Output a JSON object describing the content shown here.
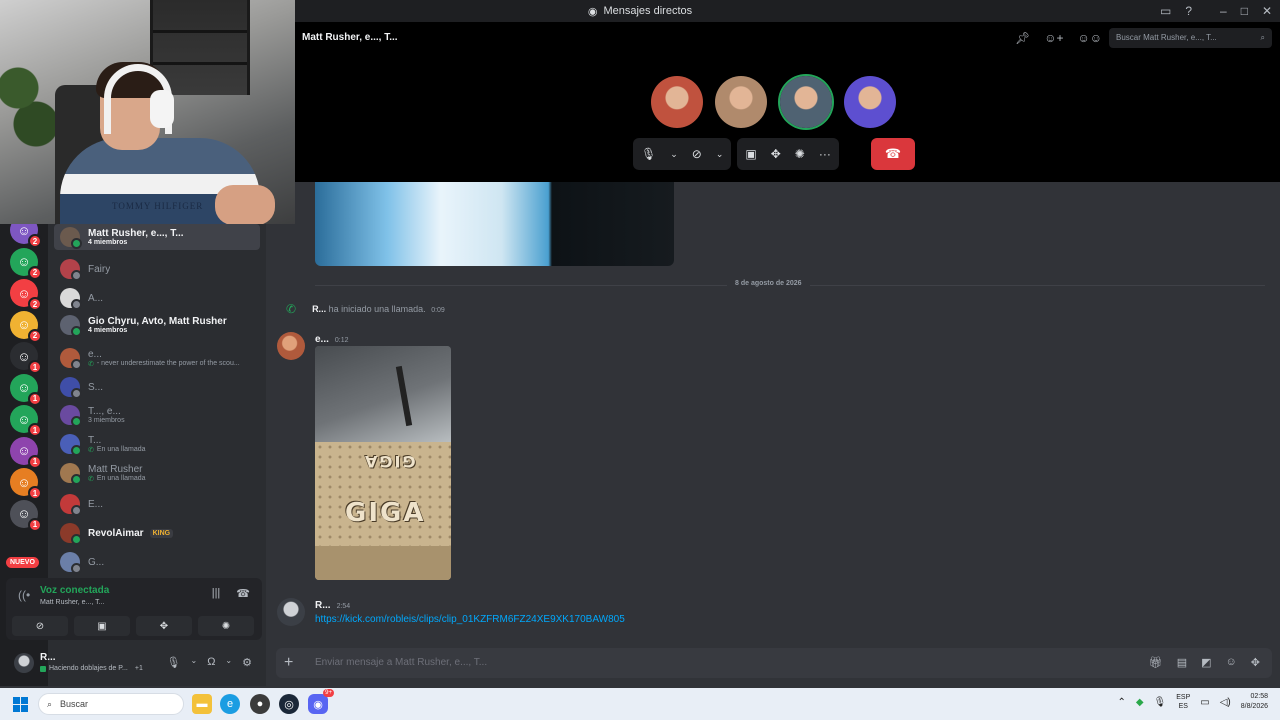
{
  "window": {
    "title": "Mensajes directos",
    "controls": [
      "inbox-icon",
      "help-icon",
      "minimize-icon",
      "maximize-icon",
      "close-icon"
    ]
  },
  "sidebar": {
    "servers": [
      {
        "badge": "2",
        "color": "#7e57c2"
      },
      {
        "badge": "2",
        "color": "#23a55a"
      },
      {
        "badge": "2",
        "color": "#f23f43"
      },
      {
        "badge": "2",
        "color": "#f0b232"
      },
      {
        "badge": "1",
        "color": "#2b2d31"
      },
      {
        "badge": "1",
        "color": "#23a55a"
      },
      {
        "badge": "1",
        "color": "#23a55a"
      },
      {
        "badge": "1",
        "color": "#8e44ad"
      },
      {
        "badge": "1",
        "color": "#e67e22"
      },
      {
        "badge": "1",
        "color": "#4e5058"
      }
    ],
    "nuevo_label": "NUEVO",
    "dms": [
      {
        "name": "Matt Rusher, e..., T...",
        "sub": "4 miembros",
        "active": true,
        "strong": true,
        "online": true,
        "color": "#6b5a4e"
      },
      {
        "name": "Fairy",
        "sub": "",
        "strong": false,
        "online": false,
        "color": "#b3424a"
      },
      {
        "name": "A...",
        "sub": "",
        "strong": false,
        "online": false,
        "color": "#d9d9d9"
      },
      {
        "name": "Gio Chyru, Avto, Matt Rusher",
        "sub": "4 miembros",
        "strong": true,
        "online": true,
        "color": "#5d6270"
      },
      {
        "name": "e...",
        "sub": "- never underestimate the power of the scou...",
        "phone": true,
        "strong": false,
        "online": false,
        "color": "#b05a3c"
      },
      {
        "name": "S...",
        "sub": "",
        "strong": false,
        "online": false,
        "color": "#3f4ea8"
      },
      {
        "name": "T..., e...",
        "sub": "3 miembros",
        "strong": false,
        "online": true,
        "color": "#6a4aa0"
      },
      {
        "name": "T...",
        "sub": "En una llamada",
        "phone": true,
        "strong": false,
        "online": true,
        "color": "#4a5fb8"
      },
      {
        "name": "Matt Rusher",
        "sub": "En una llamada",
        "phone": true,
        "strong": false,
        "online": true,
        "color": "#a07850"
      },
      {
        "name": "E...",
        "sub": "",
        "strong": false,
        "online": false,
        "color": "#c23a3a"
      },
      {
        "name": "RevolAimar",
        "sub": "",
        "strong": true,
        "online": true,
        "color": "#8b3a2a",
        "tag": "KING"
      },
      {
        "name": "G...",
        "sub": "",
        "strong": false,
        "online": false,
        "color": "#6b7fa8"
      }
    ],
    "voice": {
      "title": "Voz conectada",
      "sub": "Matt Rusher, e..., T..."
    },
    "user": {
      "name": "R...",
      "status": "Haciendo doblajes de P...",
      "extra": "+1"
    }
  },
  "call": {
    "chat_title": "Matt Rusher, e..., T...",
    "search_placeholder": "Buscar Matt Rusher, e..., T...",
    "participants": [
      {
        "color": "#c0523e",
        "speaking": false
      },
      {
        "color": "#b08a6c",
        "speaking": false
      },
      {
        "color": "#4f6272",
        "speaking": true
      },
      {
        "color": "#5d4fd0",
        "speaking": false
      }
    ]
  },
  "chat": {
    "date_divider": "8 de agosto de 2026",
    "call_event": {
      "user": "R...",
      "text": "ha iniciado una llamada.",
      "time": "0:09"
    },
    "message1": {
      "author": "e...",
      "time": "0:12",
      "photo_text_top": "GIGA",
      "photo_text_bottom": "GIGA"
    },
    "message2": {
      "author": "R...",
      "time": "2:54",
      "link": "https://kick.com/robleis/clips/clip_01KZFRM6FZ24XE9XK170BAW805"
    },
    "composer_placeholder": "Enviar mensaje a Matt Rusher, e..., T..."
  },
  "taskbar": {
    "search": "Buscar",
    "lang1": "ESP",
    "lang2": "ES",
    "time": "02:58",
    "date": "8/8/2026",
    "discord_badge": "9+"
  }
}
